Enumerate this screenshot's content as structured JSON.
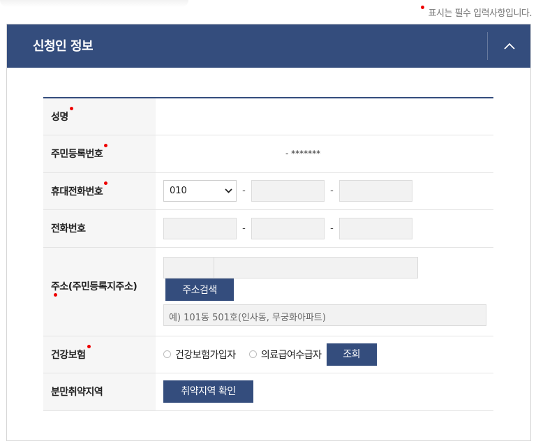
{
  "required_note": "표시는 필수 입력사항입니다.",
  "section": {
    "title": "신청인 정보"
  },
  "rows": {
    "name": {
      "label": "성명"
    },
    "resident_no": {
      "label": "주민등록번호",
      "value": "- *******"
    },
    "mobile": {
      "label": "휴대전화번호",
      "prefix_selected": "010",
      "dash": "-"
    },
    "phone": {
      "label": "전화번호",
      "dash": "-"
    },
    "address": {
      "label": "주소(주민등록지주소)",
      "search_button": "주소검색",
      "detail_placeholder": "예) 101동 501호(인사동, 무궁화아파트)"
    },
    "insurance": {
      "label": "건강보험",
      "option1": "건강보험가입자",
      "option2": "의료급여수급자",
      "button": "조회"
    },
    "vulnerable": {
      "label": "분만취약지역",
      "button": "취약지역 확인"
    }
  },
  "colors": {
    "accent": "#344d7d",
    "required": "#ee0000"
  }
}
